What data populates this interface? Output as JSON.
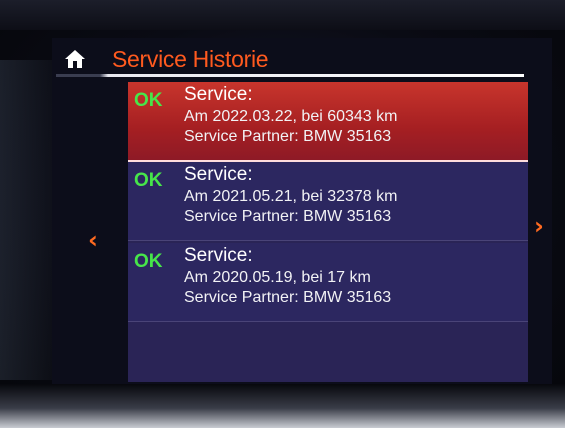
{
  "header": {
    "title": "Service Historie",
    "home_icon": "home-icon"
  },
  "colors": {
    "accent": "#ff5a1f",
    "ok_green": "#47e64a",
    "selected_row": "#b8282a",
    "list_bg": "#2c2760"
  },
  "entries": [
    {
      "status": "OK",
      "title": "Service:",
      "date_km": "Am 2022.03.22, bei 60343 km",
      "partner": "Service Partner: BMW 35163",
      "selected": true
    },
    {
      "status": "OK",
      "title": "Service:",
      "date_km": "Am 2021.05.21, bei 32378 km",
      "partner": "Service Partner: BMW 35163",
      "selected": false
    },
    {
      "status": "OK",
      "title": "Service:",
      "date_km": "Am 2020.05.19, bei 17 km",
      "partner": "Service Partner: BMW 35163",
      "selected": false
    }
  ],
  "nav": {
    "prev_icon": "chevron-left-icon",
    "prev_glyph": "‹",
    "next_icon": "chevron-right-icon",
    "next_glyph": "›"
  }
}
